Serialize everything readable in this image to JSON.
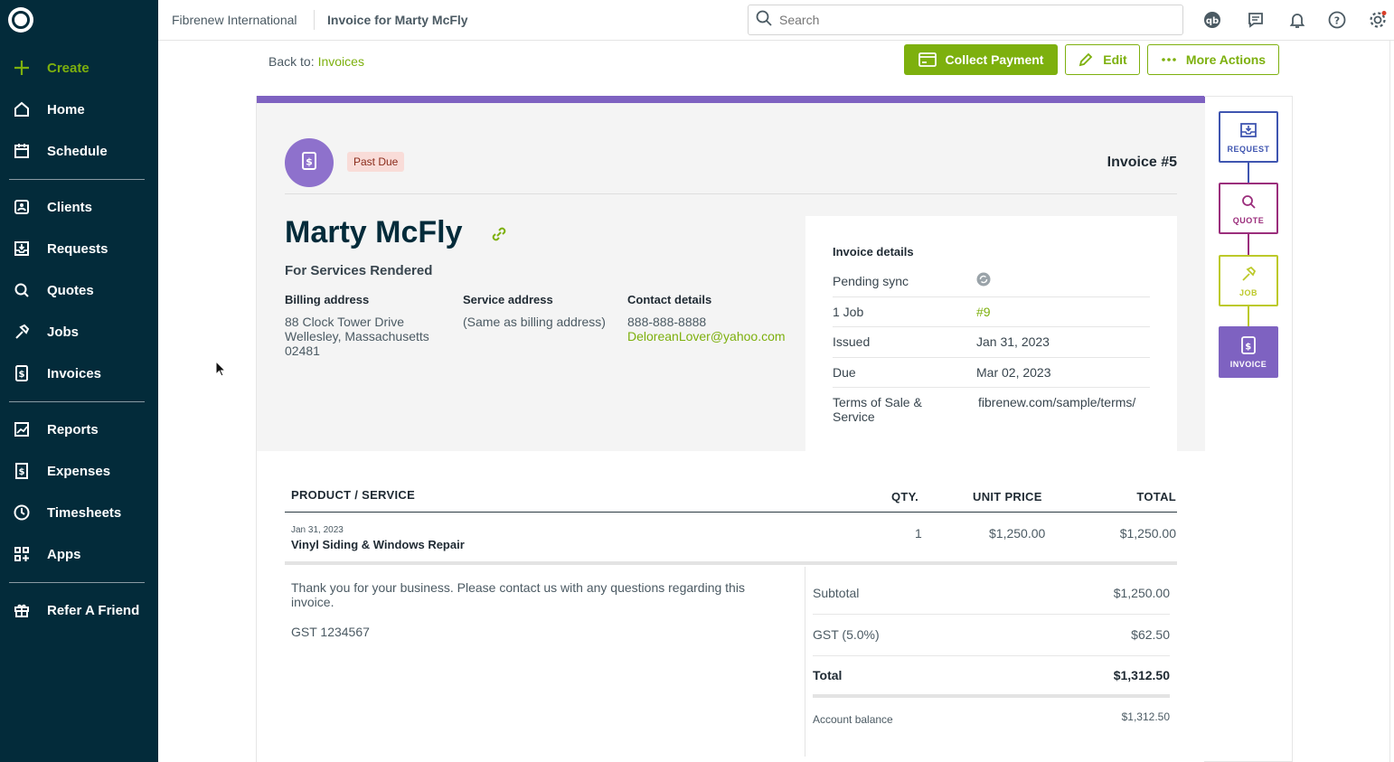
{
  "sidebar": {
    "items": [
      {
        "label": "Create",
        "icon": "plus-icon"
      },
      {
        "label": "Home",
        "icon": "home-icon"
      },
      {
        "label": "Schedule",
        "icon": "calendar-icon"
      },
      {
        "label": "Clients",
        "icon": "clients-icon"
      },
      {
        "label": "Requests",
        "icon": "requests-icon"
      },
      {
        "label": "Quotes",
        "icon": "quotes-icon"
      },
      {
        "label": "Jobs",
        "icon": "hammer-icon"
      },
      {
        "label": "Invoices",
        "icon": "invoice-icon"
      },
      {
        "label": "Reports",
        "icon": "reports-icon"
      },
      {
        "label": "Expenses",
        "icon": "expenses-icon"
      },
      {
        "label": "Timesheets",
        "icon": "clock-icon"
      },
      {
        "label": "Apps",
        "icon": "apps-icon"
      },
      {
        "label": "Refer A Friend",
        "icon": "gift-icon"
      }
    ]
  },
  "topbar": {
    "company": "Fibrenew International",
    "page_title": "Invoice for Marty McFly",
    "search_placeholder": "Search"
  },
  "actions": {
    "back_label": "Back to:",
    "back_link": "Invoices",
    "collect_payment": "Collect Payment",
    "edit": "Edit",
    "more_actions": "More Actions"
  },
  "invoice": {
    "status": "Past Due",
    "number": "Invoice #5",
    "client_name": "Marty McFly",
    "subtitle": "For Services Rendered",
    "billing_heading": "Billing address",
    "billing_line1": "88 Clock Tower Drive",
    "billing_line2": "Wellesley, Massachusetts",
    "billing_line3": "02481",
    "service_heading": "Service address",
    "service_value": "(Same as billing address)",
    "contact_heading": "Contact details",
    "phone": "888-888-8888",
    "email": "DeloreanLover@yahoo.com",
    "details": {
      "heading": "Invoice details",
      "pending_sync": "Pending sync",
      "job_label": "1 Job",
      "job_value": "#9",
      "issued_label": "Issued",
      "issued_value": "Jan 31, 2023",
      "due_label": "Due",
      "due_value": "Mar 02, 2023",
      "terms_label": "Terms of Sale & Service",
      "terms_value": "fibrenew.com/sample/terms/"
    },
    "table": {
      "col_product": "PRODUCT / SERVICE",
      "col_qty": "QTY.",
      "col_unit": "UNIT PRICE",
      "col_total": "TOTAL",
      "row_date": "Jan 31, 2023",
      "row_name": "Vinyl Siding & Windows Repair",
      "row_qty": "1",
      "row_unit": "$1,250.00",
      "row_total": "$1,250.00"
    },
    "message": "Thank you for your business. Please contact us with any questions regarding this invoice.",
    "gst_number": "GST 1234567",
    "totals": {
      "subtotal_label": "Subtotal",
      "subtotal": "$1,250.00",
      "gst_label": "GST (5.0%)",
      "gst": "$62.50",
      "total_label": "Total",
      "total": "$1,312.50",
      "balance_label": "Account balance",
      "balance": "$1,312.50"
    }
  },
  "workflow": {
    "request": "REQUEST",
    "quote": "QUOTE",
    "job": "JOB",
    "invoice": "INVOICE",
    "colors": {
      "request": "#3f55b0",
      "quote": "#9b2e7c",
      "job": "#bcc929",
      "invoice": "#7e62c1"
    }
  },
  "colors": {
    "sidebar": "#032b3a",
    "accent": "#7db00e",
    "purple": "#7e62c1"
  }
}
